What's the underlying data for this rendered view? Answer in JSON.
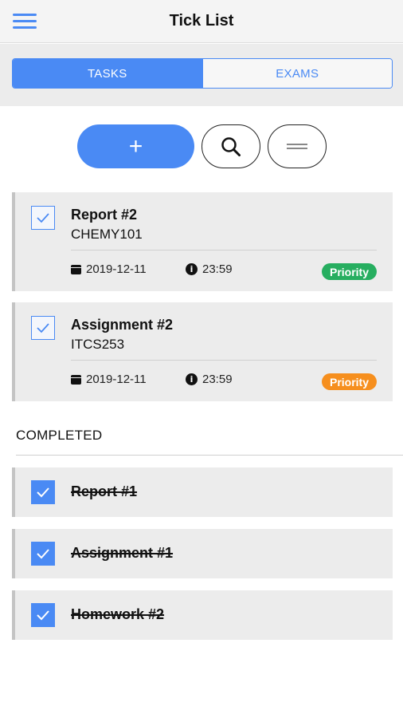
{
  "header": {
    "title": "Tick List"
  },
  "tabs": [
    {
      "label": "TASKS",
      "active": true
    },
    {
      "label": "EXAMS",
      "active": false
    }
  ],
  "actions": {
    "add_symbol": "+"
  },
  "tasks": [
    {
      "title": "Report #2",
      "course": "CHEMY101",
      "date": "2019-12-11",
      "time": "23:59",
      "badge": "Priority",
      "badge_color": "#27ae60",
      "done": false
    },
    {
      "title": "Assignment #2",
      "course": "ITCS253",
      "date": "2019-12-11",
      "time": "23:59",
      "badge": "Priority",
      "badge_color": "#f68f1e",
      "done": false
    }
  ],
  "completed": {
    "label": "COMPLETED",
    "items": [
      {
        "title": "Report #1",
        "done": true
      },
      {
        "title": "Assignment #1",
        "done": true
      },
      {
        "title": "Homework #2",
        "done": true
      }
    ]
  },
  "colors": {
    "accent": "#4a8af4",
    "card_bg": "#ececec"
  }
}
